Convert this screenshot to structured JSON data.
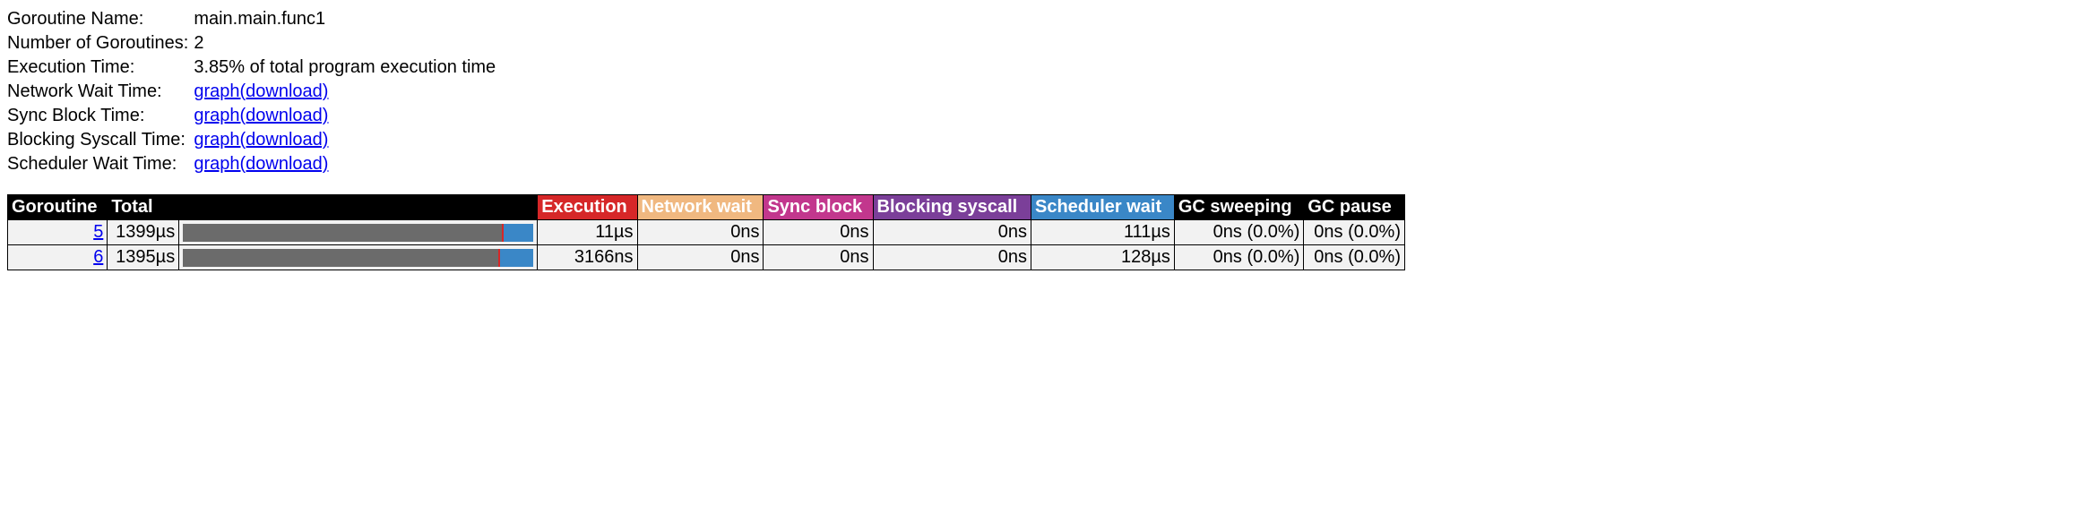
{
  "info": {
    "name_label": "Goroutine Name:",
    "name_value": "main.main.func1",
    "count_label": "Number of Goroutines:",
    "count_value": "2",
    "exec_label": "Execution Time:",
    "exec_value": "3.85% of total program execution time",
    "network_label": "Network Wait Time:",
    "sync_label": "Sync Block Time:",
    "blocking_label": "Blocking Syscall Time:",
    "scheduler_label": "Scheduler Wait Time:",
    "graph_text": "graph",
    "download_text": "(download)"
  },
  "headers": {
    "goroutine": "Goroutine",
    "total": "Total",
    "execution": "Execution",
    "network": "Network wait",
    "sync": "Sync block",
    "blocking": "Blocking syscall",
    "scheduler": "Scheduler wait",
    "gc_sweeping": "GC sweeping",
    "gc_pause": "GC pause"
  },
  "rows": [
    {
      "id": "5",
      "total": "1399µs",
      "execution": "11µs",
      "network": "0ns",
      "sync": "0ns",
      "blocking": "0ns",
      "scheduler": "111µs",
      "gc_sweeping": "0ns (0.0%)",
      "gc_pause": "0ns (0.0%)",
      "bar": {
        "gray": 91,
        "red": 0.6,
        "blue": 8.4
      }
    },
    {
      "id": "6",
      "total": "1395µs",
      "execution": "3166ns",
      "network": "0ns",
      "sync": "0ns",
      "blocking": "0ns",
      "scheduler": "128µs",
      "gc_sweeping": "0ns (0.0%)",
      "gc_pause": "0ns (0.0%)",
      "bar": {
        "gray": 90,
        "red": 0.4,
        "blue": 9.6
      }
    }
  ]
}
